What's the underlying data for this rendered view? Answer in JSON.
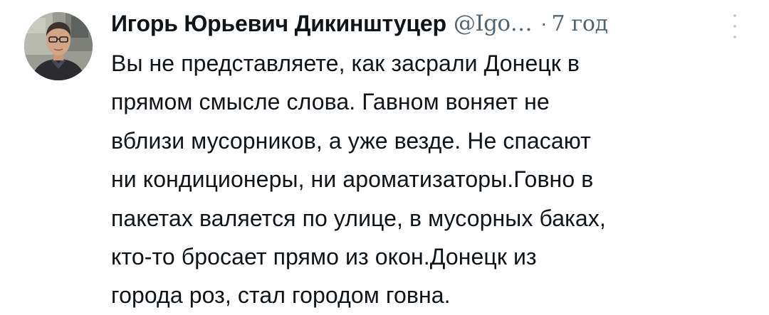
{
  "tweet": {
    "author_name": "Игорь Юрьевич Дикинштуцер",
    "author_handle": "@Igo…",
    "separator": "·",
    "timestamp": "7 год",
    "avatar": "author-avatar-photo",
    "more_icon": "more-vertical-icon",
    "text_lines": [
      "Вы не представляете, как засрали Донецк в",
      "прямом смысле слова. Гавном воняет не",
      "вблизи мусорников, а уже везде. Не спасают",
      "ни кондиционеры, ни ароматизаторы.Говно в",
      "пакетах валяется по улице, в мусорных баках,",
      "кто-то бросает прямо из окон.Донецк из",
      "города роз, стал городом говна."
    ]
  },
  "colors": {
    "text": "#0f1419",
    "secondary": "#536471",
    "background": "#ffffff"
  }
}
